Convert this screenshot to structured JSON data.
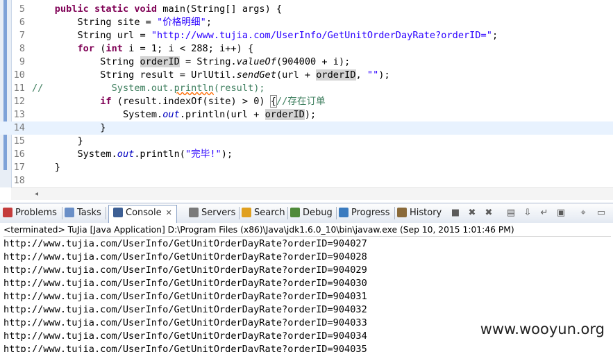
{
  "editor": {
    "line_numbers": [
      "5",
      "6",
      "7",
      "8",
      "9",
      "10",
      "11",
      "12",
      "13",
      "14",
      "15",
      "16",
      "17",
      "18"
    ],
    "lines": [
      [
        {
          "t": "    "
        },
        {
          "t": "public static void",
          "c": "kw"
        },
        {
          "t": " main(String[] args) {"
        }
      ],
      [
        {
          "t": "        String site = "
        },
        {
          "t": "\"价格明细\"",
          "c": "str"
        },
        {
          "t": ";"
        }
      ],
      [
        {
          "t": "        String url = "
        },
        {
          "t": "\"http://www.tujia.com/UserInfo/GetUnitOrderDayRate?orderID=\"",
          "c": "str"
        },
        {
          "t": ";"
        }
      ],
      [
        {
          "t": "        "
        },
        {
          "t": "for",
          "c": "kw"
        },
        {
          "t": " ("
        },
        {
          "t": "int",
          "c": "kw"
        },
        {
          "t": " i = 1; i < 288; i++) {"
        }
      ],
      [
        {
          "t": "            String "
        },
        {
          "t": "orderID",
          "c": "hl"
        },
        {
          "t": " = String."
        },
        {
          "t": "valueOf",
          "c": "it"
        },
        {
          "t": "(904000 + i);"
        }
      ],
      [
        {
          "t": "            String result = UrlUtil."
        },
        {
          "t": "sendGet",
          "c": "it"
        },
        {
          "t": "(url + "
        },
        {
          "t": "orderID",
          "c": "hl"
        },
        {
          "t": ", "
        },
        {
          "t": "\"\"",
          "c": "str"
        },
        {
          "t": ");"
        }
      ],
      [
        {
          "t": "//",
          "c": "cmt"
        },
        {
          "t": "            System.out.",
          "c": "cmt"
        },
        {
          "t": "println",
          "c": "cmt sq"
        },
        {
          "t": "(result);",
          "c": "cmt"
        }
      ],
      [
        {
          "t": "            "
        },
        {
          "t": "if",
          "c": "kw"
        },
        {
          "t": " (result.indexOf(site) > 0) "
        },
        {
          "t": "{",
          "c": "bracket"
        },
        {
          "t": "//存在订单",
          "c": "cmt"
        }
      ],
      [
        {
          "t": "                System."
        },
        {
          "t": "out",
          "c": "fld"
        },
        {
          "t": ".println(url + "
        },
        {
          "t": "orderID",
          "c": "hl"
        },
        {
          "t": ");"
        }
      ],
      [
        {
          "t": "            }"
        }
      ],
      [
        {
          "t": "        }"
        }
      ],
      [
        {
          "t": "        System."
        },
        {
          "t": "out",
          "c": "fld"
        },
        {
          "t": ".println("
        },
        {
          "t": "\"完毕!\"",
          "c": "str"
        },
        {
          "t": ");"
        }
      ],
      [
        {
          "t": "    }"
        }
      ],
      [
        {
          "t": ""
        }
      ]
    ],
    "current_line_index": 9,
    "scroll_left_arrow": "◂"
  },
  "tabs": [
    {
      "label": "Problems",
      "icon": "problems-icon",
      "color": "#c43b3b"
    },
    {
      "label": "Tasks",
      "icon": "tasks-icon",
      "color": "#6a8fc7"
    },
    {
      "label": "Console",
      "icon": "console-icon",
      "color": "#3d5f94",
      "active": true,
      "close": "✕"
    },
    {
      "label": "Servers",
      "icon": "servers-icon",
      "color": "#7a7a7a"
    },
    {
      "label": "Search",
      "icon": "search-icon",
      "color": "#e0a020"
    },
    {
      "label": "Debug",
      "icon": "debug-icon",
      "color": "#4f8a3a"
    },
    {
      "label": "Progress",
      "icon": "progress-icon",
      "color": "#3b7bbf"
    },
    {
      "label": "History",
      "icon": "history-icon",
      "color": "#8a6a3a"
    }
  ],
  "toolbar": [
    {
      "name": "stop-icon",
      "glyph": "■"
    },
    {
      "name": "remove-launch-icon",
      "glyph": "✖"
    },
    {
      "name": "remove-all-icon",
      "glyph": "✖"
    },
    {
      "name": "clear-console-icon",
      "glyph": "▤"
    },
    {
      "name": "scroll-lock-icon",
      "glyph": "⇩"
    },
    {
      "name": "word-wrap-icon",
      "glyph": "↵"
    },
    {
      "name": "show-on-output-icon",
      "glyph": "▣"
    },
    {
      "name": "pin-console-icon",
      "glyph": "⌖"
    },
    {
      "name": "display-console-icon",
      "glyph": "▭"
    }
  ],
  "console": {
    "terminated": "<terminated> TuJia [Java Application] D:\\Program Files (x86)\\Java\\jdk1.6.0_10\\bin\\javaw.exe (Sep 10, 2015 1:01:46 PM)",
    "lines": [
      "http://www.tujia.com/UserInfo/GetUnitOrderDayRate?orderID=904027",
      "http://www.tujia.com/UserInfo/GetUnitOrderDayRate?orderID=904028",
      "http://www.tujia.com/UserInfo/GetUnitOrderDayRate?orderID=904029",
      "http://www.tujia.com/UserInfo/GetUnitOrderDayRate?orderID=904030",
      "http://www.tujia.com/UserInfo/GetUnitOrderDayRate?orderID=904031",
      "http://www.tujia.com/UserInfo/GetUnitOrderDayRate?orderID=904032",
      "http://www.tujia.com/UserInfo/GetUnitOrderDayRate?orderID=904033",
      "http://www.tujia.com/UserInfo/GetUnitOrderDayRate?orderID=904034",
      "http://www.tujia.com/UserInfo/GetUnitOrderDayRate?orderID=904035"
    ]
  },
  "watermark": "www.wooyun.org"
}
